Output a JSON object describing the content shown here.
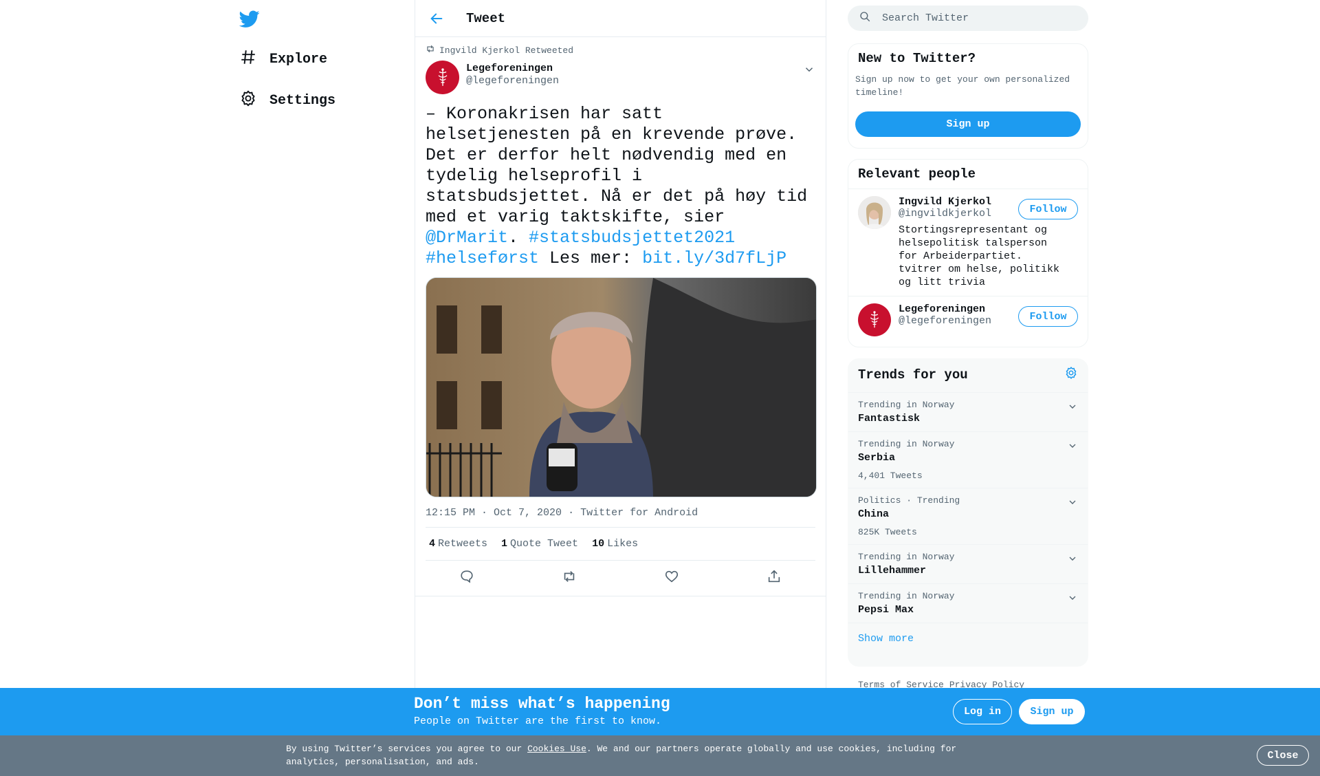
{
  "nav": {
    "items": [
      {
        "label": "Explore"
      },
      {
        "label": "Settings"
      }
    ]
  },
  "header": {
    "title": "Tweet"
  },
  "tweet": {
    "retweeted_by": "Ingvild Kjerkol Retweeted",
    "author_name": "Legeforeningen",
    "author_handle": "@legeforeningen",
    "text_part1": "– Koronakrisen har satt helsetjenesten på en krevende prøve. Det er derfor helt nødvendig med en tydelig helseprofil i statsbudsjettet. Nå er det på høy tid med et varig taktskifte, sier ",
    "mention": "@DrMarit",
    "text_part2": ". ",
    "hashtag1": "#statsbudsjettet2021",
    "hashtag2": "#helseførst",
    "text_part3": " Les mer: ",
    "link": "bit.ly/3d7fLjP",
    "time": "12:15 PM · Oct 7, 2020",
    "source": "Twitter for Android",
    "retweets_count": "4",
    "retweets_label": "Retweets",
    "quotes_count": "1",
    "quotes_label": "Quote Tweet",
    "likes_count": "10",
    "likes_label": "Likes"
  },
  "search": {
    "placeholder": "Search Twitter"
  },
  "new_to_twitter": {
    "title": "New to Twitter?",
    "subtitle": "Sign up now to get your own personalized timeline!",
    "button": "Sign up"
  },
  "relevant_people": {
    "title": "Relevant people",
    "people": [
      {
        "name": "Ingvild Kjerkol",
        "handle": "@ingvildkjerkol",
        "bio": "Stortingsrepresentant og helsepolitisk talsperson for Arbeiderpartiet. tvitrer om helse, politikk og litt trivia",
        "follow": "Follow"
      },
      {
        "name": "Legeforeningen",
        "handle": "@legeforeningen",
        "bio": "",
        "follow": "Follow"
      }
    ]
  },
  "trends": {
    "title": "Trends for you",
    "items": [
      {
        "meta": "Trending in Norway",
        "name": "Fantastisk",
        "count": ""
      },
      {
        "meta": "Trending in Norway",
        "name": "Serbia",
        "count": "4,401 Tweets"
      },
      {
        "meta": "Politics · Trending",
        "name": "China",
        "count": "825K Tweets"
      },
      {
        "meta": "Trending in Norway",
        "name": "Lillehammer",
        "count": ""
      },
      {
        "meta": "Trending in Norway",
        "name": "Pepsi Max",
        "count": ""
      }
    ],
    "show_more": "Show more"
  },
  "footer": {
    "terms": "Terms of Service",
    "privacy": "Privacy Policy"
  },
  "bottom_bar": {
    "headline": "Don’t miss what’s happening",
    "subline": "People on Twitter are the first to know.",
    "login": "Log in",
    "signup": "Sign up"
  },
  "cookie": {
    "prefix": "By using Twitter’s services you agree to our ",
    "link": "Cookies Use",
    "suffix": ". We and our partners operate globally and use cookies, including for analytics, personalisation, and ads.",
    "close": "Close"
  },
  "colors": {
    "accent": "#1d9bf0",
    "brand_red": "#c8102e",
    "cookie_bg": "#657786"
  }
}
